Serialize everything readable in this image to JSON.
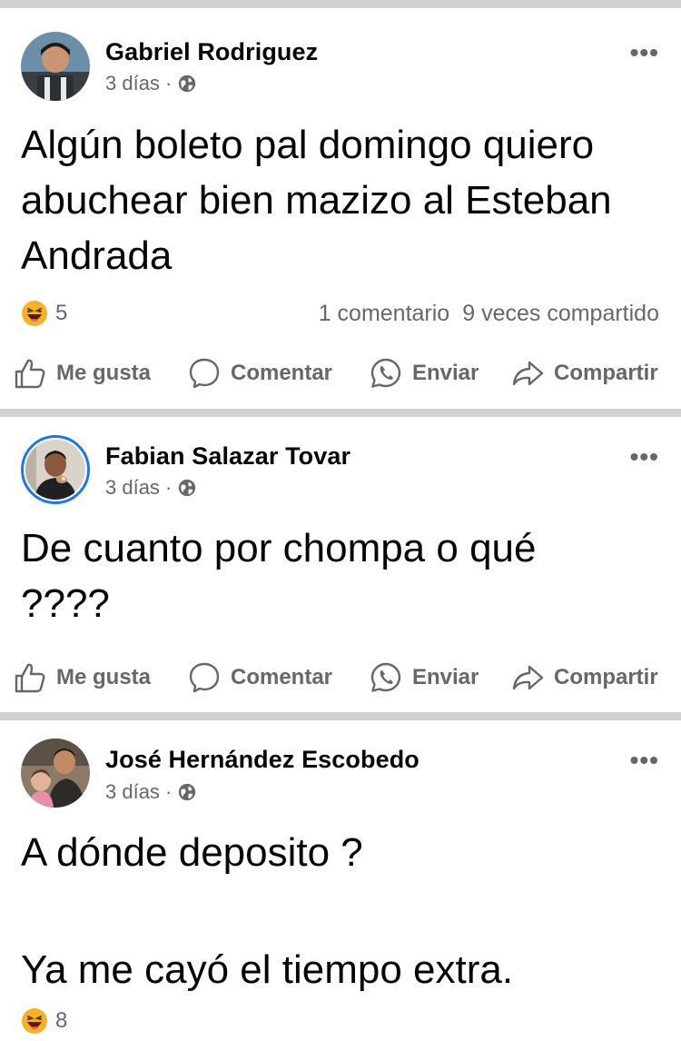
{
  "posts": [
    {
      "author": "Gabriel Rodriguez",
      "time": "3 días",
      "dot": "·",
      "more": "•••",
      "body": "Algún boleto pal domingo quiero abuchear bien mazizo al Esteban Andrada",
      "reaction_count": "5",
      "comments": "1 comentario",
      "shares": "9 veces compartido"
    },
    {
      "author": "Fabian Salazar Tovar",
      "time": "3 días",
      "dot": "·",
      "more": "•••",
      "body": "De cuanto por chompa o qué ????"
    },
    {
      "author": "José Hernández Escobedo",
      "time": "3 días",
      "dot": "·",
      "more": "•••",
      "body_line1": "A dónde deposito ?",
      "body_line2": "Ya me cayó el tiempo extra.",
      "reaction_count": "8"
    }
  ],
  "actions": {
    "like": "Me gusta",
    "comment": "Comentar",
    "send": "Enviar",
    "share": "Compartir"
  },
  "icons": {
    "like": "thumbs-up-icon",
    "comment": "comment-bubble-icon",
    "send": "whatsapp-icon",
    "share": "share-arrow-icon",
    "privacy": "globe-icon",
    "reaction": "haha-emoji-icon"
  },
  "colors": {
    "divider": "#ced0d4",
    "secondary_text": "#65676b",
    "primary_text": "#050505",
    "accent": "#1877f2"
  }
}
